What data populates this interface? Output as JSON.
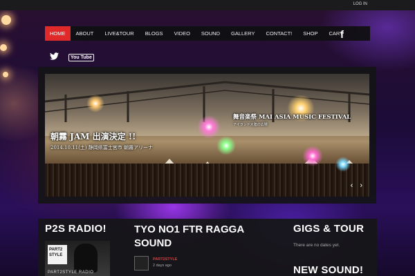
{
  "topbar": {
    "login_label": "LOG IN"
  },
  "nav": {
    "items": [
      {
        "label": "HOME",
        "active": true
      },
      {
        "label": "ABOUT"
      },
      {
        "label": "LIVE&TOUR"
      },
      {
        "label": "BLOGS"
      },
      {
        "label": "VIDEO"
      },
      {
        "label": "SOUND"
      },
      {
        "label": "GALLERY"
      },
      {
        "label": "CONTACT!"
      },
      {
        "label": "SHOP"
      },
      {
        "label": "CART"
      }
    ],
    "facebook_glyph": "f"
  },
  "social": {
    "youtube_label": "You Tube"
  },
  "slider": {
    "jam_title": "朝霧 JAM 出演決定 !!",
    "jam_subtitle": "2014.10.11(土) 静岡県富士宮市 朝霧アリーナ",
    "fest_title": "舞音楽祭 MAI ASIA MUSIC FESTIVAL",
    "fest_subtitle": "アイランド大陸の広場",
    "prev_glyph": "‹",
    "next_glyph": "›"
  },
  "bottom": {
    "radio_title": "P2S RADIO!",
    "radio_logo_text": "PART2 STYLE",
    "radio_caption": "PART2STYLE RADIO",
    "post_title": "TYO NO1 FTR RAGGA SOUND",
    "post_author": "PART2STYLE",
    "post_date": "2 days ago",
    "gigs_title": "GIGS & TOUR",
    "gigs_note": "There are no dates yet.",
    "new_sound_title": "NEW SOUND!"
  },
  "colors": {
    "accent": "#e02a2a",
    "panel": "#161618",
    "topbar": "#1b1b1d"
  }
}
